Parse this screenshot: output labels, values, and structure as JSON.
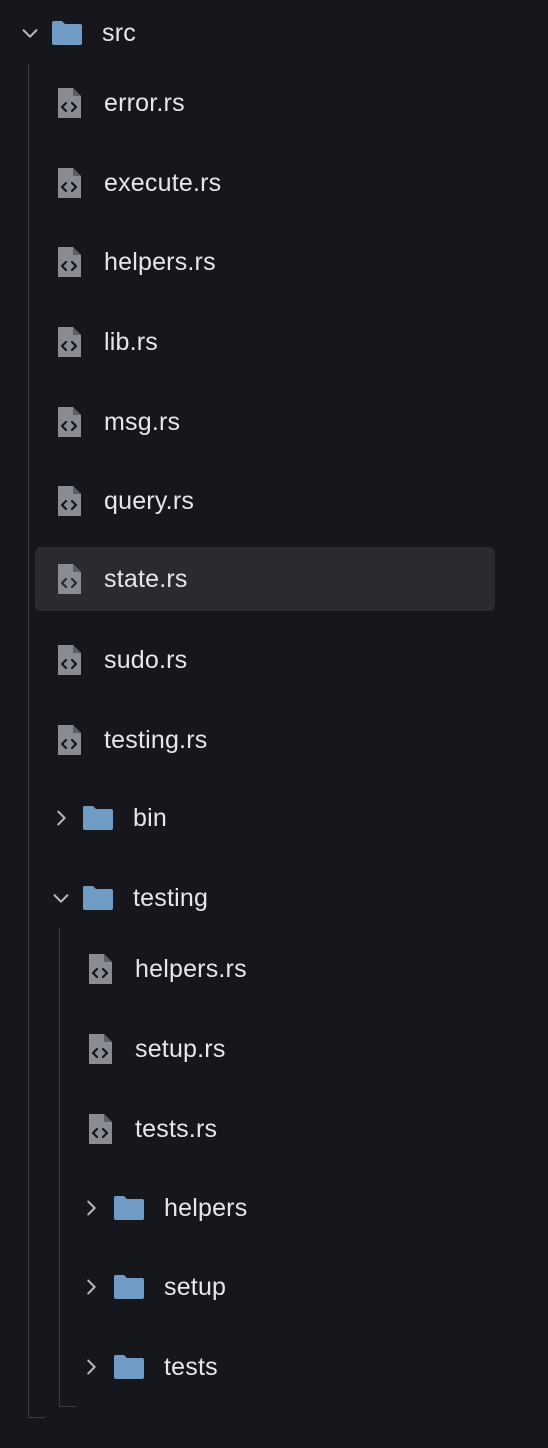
{
  "colors": {
    "background": "#16171c",
    "text": "#e6e7ea",
    "selected_row": "#2a2b31",
    "folder_icon": "#6f9bc4",
    "file_icon": "#8a8c93",
    "chevron": "#b7b9bf",
    "guide_line": "#3a3c44"
  },
  "tree": {
    "root": {
      "label": "src",
      "expanded": true,
      "icon": "folder-icon",
      "chevron": "chevron-down-icon"
    },
    "files": [
      {
        "label": "error.rs",
        "icon": "rust-file-icon"
      },
      {
        "label": "execute.rs",
        "icon": "rust-file-icon"
      },
      {
        "label": "helpers.rs",
        "icon": "rust-file-icon"
      },
      {
        "label": "lib.rs",
        "icon": "rust-file-icon"
      },
      {
        "label": "msg.rs",
        "icon": "rust-file-icon"
      },
      {
        "label": "query.rs",
        "icon": "rust-file-icon"
      },
      {
        "label": "state.rs",
        "icon": "rust-file-icon",
        "selected": true
      },
      {
        "label": "sudo.rs",
        "icon": "rust-file-icon"
      },
      {
        "label": "testing.rs",
        "icon": "rust-file-icon"
      }
    ],
    "bin_folder": {
      "label": "bin",
      "expanded": false,
      "icon": "folder-icon",
      "chevron": "chevron-right-icon"
    },
    "testing_folder": {
      "label": "testing",
      "expanded": true,
      "icon": "folder-icon",
      "chevron": "chevron-down-icon",
      "files": [
        {
          "label": "helpers.rs",
          "icon": "rust-file-icon"
        },
        {
          "label": "setup.rs",
          "icon": "rust-file-icon"
        },
        {
          "label": "tests.rs",
          "icon": "rust-file-icon"
        }
      ],
      "folders": [
        {
          "label": "helpers",
          "expanded": false,
          "icon": "folder-icon",
          "chevron": "chevron-right-icon"
        },
        {
          "label": "setup",
          "expanded": false,
          "icon": "folder-icon",
          "chevron": "chevron-right-icon"
        },
        {
          "label": "tests",
          "expanded": false,
          "icon": "folder-icon",
          "chevron": "chevron-right-icon"
        }
      ]
    }
  }
}
